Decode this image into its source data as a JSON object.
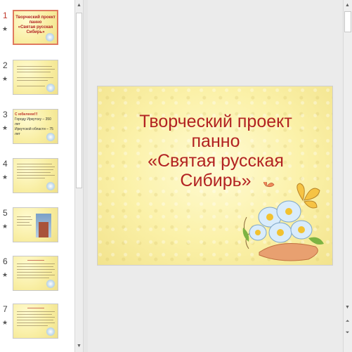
{
  "slides": [
    {
      "number": "1",
      "title_lines": [
        "Творческий проект",
        "панно",
        "«Святая русская",
        "Сибирь»"
      ],
      "active": true
    },
    {
      "number": "2"
    },
    {
      "number": "3",
      "title_lines": [
        "С юбилеем!!!",
        "Городу Иркутску – 350 лет",
        "Иркутской области – 75 лет"
      ]
    },
    {
      "number": "4"
    },
    {
      "number": "5"
    },
    {
      "number": "6"
    },
    {
      "number": "7"
    }
  ],
  "main_slide": {
    "title_lines": [
      "Творческий проект",
      "панно",
      "«Святая русская",
      "Сибирь»"
    ]
  },
  "colors": {
    "title": "#b22222",
    "active_border": "#e07a5f"
  },
  "icons": {
    "star": "star-icon",
    "scroll_up": "up-arrow-icon",
    "scroll_down": "down-arrow-icon"
  }
}
